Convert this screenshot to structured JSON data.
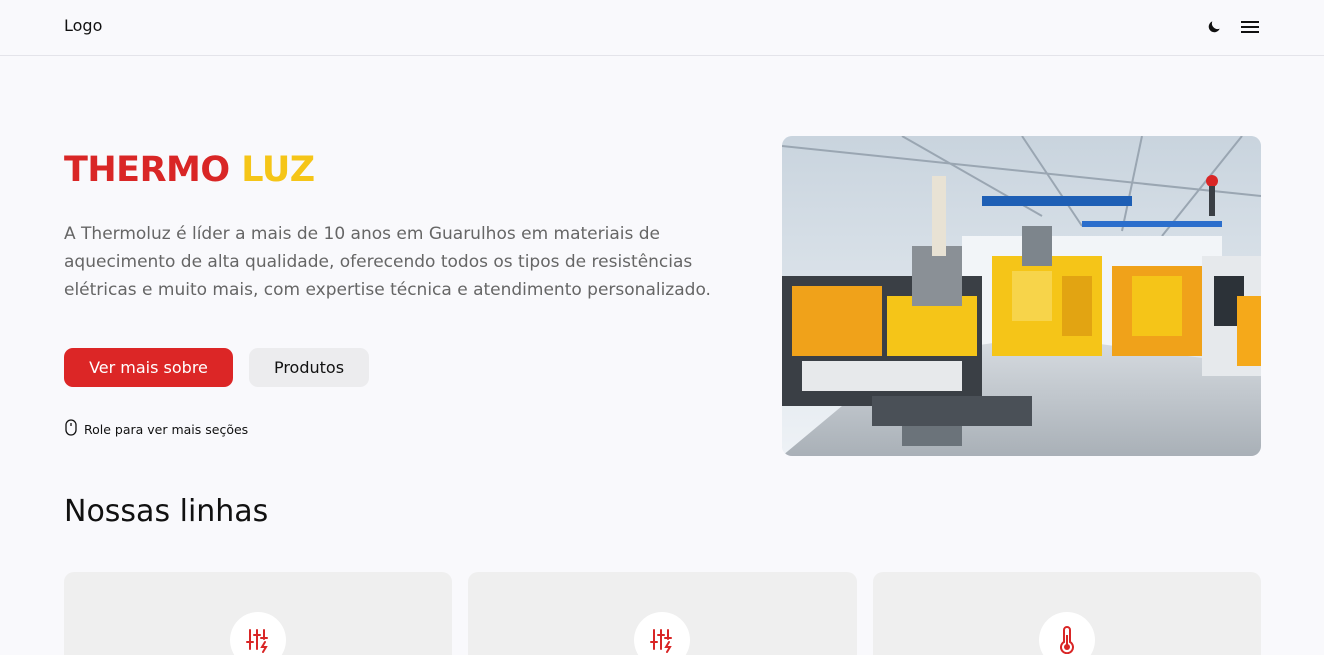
{
  "header": {
    "logo_text": "Logo",
    "theme_icon": "moon-icon",
    "menu_icon": "hamburger-menu-icon"
  },
  "hero": {
    "title_part1": "THERMO",
    "title_part2": "LUZ",
    "description": "A Thermoluz é líder a mais de 10 anos em Guarulhos em materiais de aquecimento de alta qualidade, oferecendo todos os tipos de resistências elétricas e muito mais, com expertise técnica e atendimento personalizado.",
    "primary_button": "Ver mais sobre",
    "secondary_button": "Produtos",
    "scroll_hint": "Role para ver mais seções",
    "image_subject": "industrial-factory-machinery"
  },
  "section": {
    "title": "Nossas linhas",
    "cards": [
      {
        "icon": "sliders-bolt-icon"
      },
      {
        "icon": "sliders-bolt-icon"
      },
      {
        "icon": "thermometer-icon"
      }
    ]
  },
  "colors": {
    "brand_red": "#dc2626",
    "brand_yellow": "#f5c518",
    "background": "#f9f9fc",
    "card_bg": "#efefef"
  }
}
